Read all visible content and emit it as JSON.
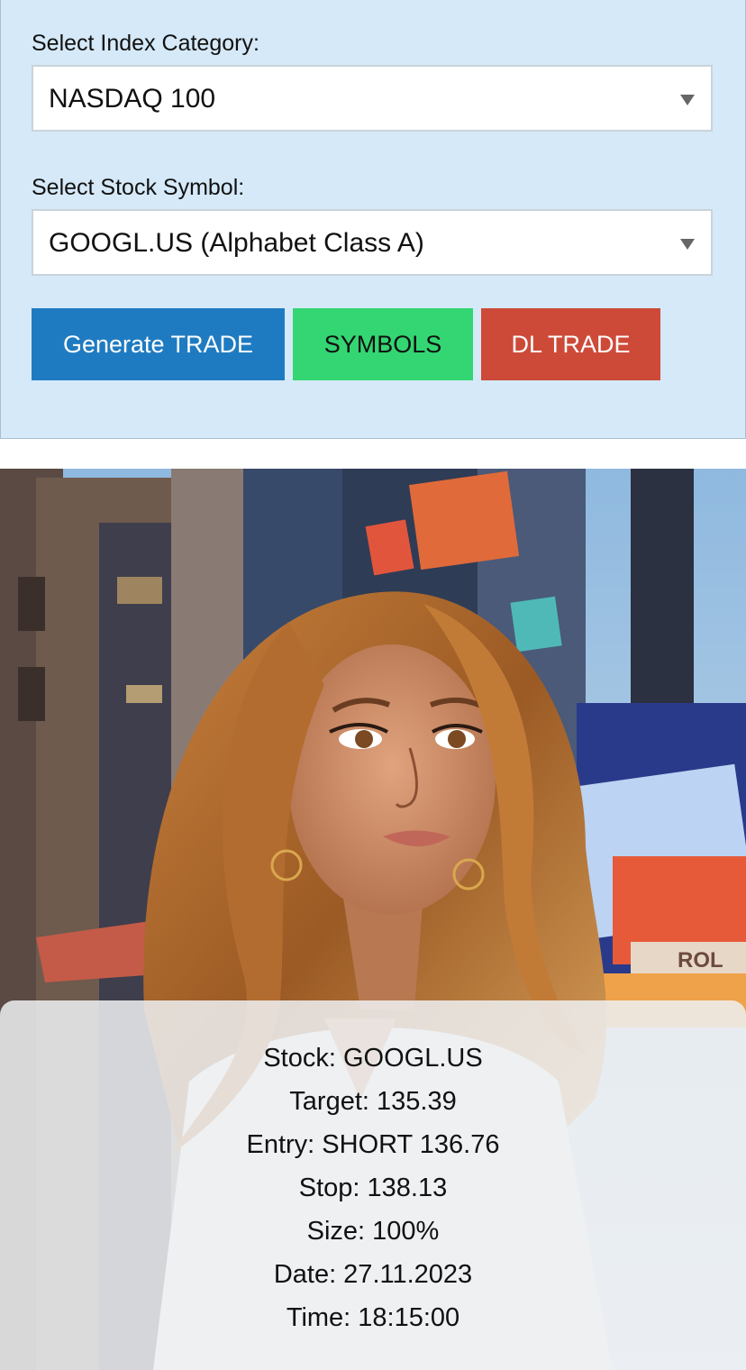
{
  "form": {
    "index_label": "Select Index Category:",
    "index_value": "NASDAQ 100",
    "symbol_label": "Select Stock Symbol:",
    "symbol_value": "GOOGL.US (Alphabet Class A)",
    "buttons": {
      "generate": "Generate TRADE",
      "symbols": "SYMBOLS",
      "dl_trade": "DL TRADE"
    },
    "colors": {
      "panel_bg": "#d5e9f8",
      "generate": "#1f7bc1",
      "symbols": "#33d673",
      "dl_trade": "#cd4a39"
    }
  },
  "hero": {
    "sign_text": "ROL"
  },
  "trade": {
    "stock": "Stock: GOOGL.US",
    "target": "Target: 135.39",
    "entry": "Entry: SHORT 136.76",
    "stop": "Stop: 138.13",
    "size": "Size: 100%",
    "date": "Date: 27.11.2023",
    "time": "Time: 18:15:00"
  }
}
